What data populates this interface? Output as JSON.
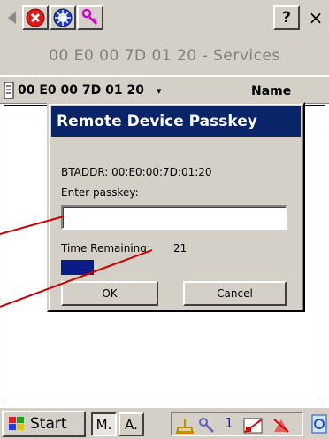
{
  "toolbar": {
    "back_icon": "back-arrow-icon",
    "help_label": "?",
    "close_label": "×"
  },
  "window": {
    "title": "00 E0 00 7D 01 20 - Services"
  },
  "combo": {
    "device_value": "00 E0 00 7D 01 20",
    "sort_value": "Name"
  },
  "dialog": {
    "title": "Remote Device Passkey",
    "btaddr_label": "BTADDR: 00:E0:00:7D:01:20",
    "passkey_label": "Enter passkey:",
    "passkey_value": "",
    "time_label": "Time Remaining:",
    "time_value": "21",
    "progress_fraction": 0.15,
    "ok_label": "OK",
    "cancel_label": "Cancel"
  },
  "taskbar": {
    "start_label": "Start",
    "task1_label": "M.",
    "task2_label": "A.",
    "tray_number": "1"
  },
  "colors": {
    "titlebar": "#0a246a",
    "progress": "#0a1c8a",
    "chrome": "#d4d0c8",
    "annotation": "#cc0000"
  }
}
